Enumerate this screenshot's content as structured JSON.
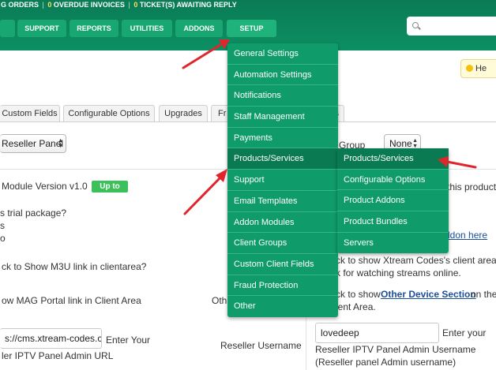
{
  "topbar": {
    "pending_orders": "G ORDERS",
    "sep1": "|",
    "overdue_count": "0",
    "overdue_label": "OVERDUE INVOICES",
    "sep2": "|",
    "tickets_count": "0",
    "tickets_label": "TICKET(S) AWAITING REPLY"
  },
  "nav": {
    "support": "SUPPORT",
    "reports": "REPORTS",
    "utilities": "UTILITIES",
    "addons": "ADDONS",
    "setup": "SETUP"
  },
  "help": {
    "label": "He"
  },
  "tabs": {
    "custom_fields": "Custom Fields",
    "configurable_options": "Configurable Options",
    "upgrades": "Upgrades",
    "fr": "Fr",
    "s": "s"
  },
  "form": {
    "reseller_panel_select": "Reseller Panel",
    "group_label": "Group",
    "none_select": "None",
    "module_version": "Module Version v1.0",
    "up_to_badge": "Up to",
    "this_product": "this product",
    "trial_package": "s trial package?",
    "s_line": "s",
    "o_line": "o",
    "addon_here": "ddon here",
    "m3u_question": "ck to Show M3U link in clientarea?",
    "xtream_client_area": "ck to show Xtream Codes's client area",
    "watching_streams": "k for watching streams online.",
    "mag_portal": "ow MAG Portal link in Client Area",
    "oth": "Oth",
    "ck_to_show": "ck to show",
    "other_device_section": "Other Device Section",
    "on_the": "on the",
    "client_area": "ient Area.",
    "url_input_value": "s://cms.xtream-codes.c",
    "enter_your": "Enter Your",
    "admin_url": "ler IPTV Panel Admin URL",
    "reseller_username_label": "Reseller Username",
    "username_input_value": "lovedeep",
    "enter_your_2": "Enter your",
    "admin_username": "Reseller IPTV Panel Admin Username",
    "admin_username_hint": "(Reseller panel Admin username)"
  },
  "setup_menu": [
    "General Settings",
    "Automation Settings",
    "Notifications",
    "Staff Management",
    "Payments",
    "Products/Services",
    "Support",
    "Email Templates",
    "Addon Modules",
    "Client Groups",
    "Custom Client Fields",
    "Fraud Protection",
    "Other"
  ],
  "products_submenu": [
    "Products/Services",
    "Configurable Options",
    "Product Addons",
    "Product Bundles",
    "Servers"
  ],
  "colors": {
    "header_green": "#0c8f63",
    "menu_green": "#0f9c6a",
    "arrow_red": "#e0262d"
  }
}
